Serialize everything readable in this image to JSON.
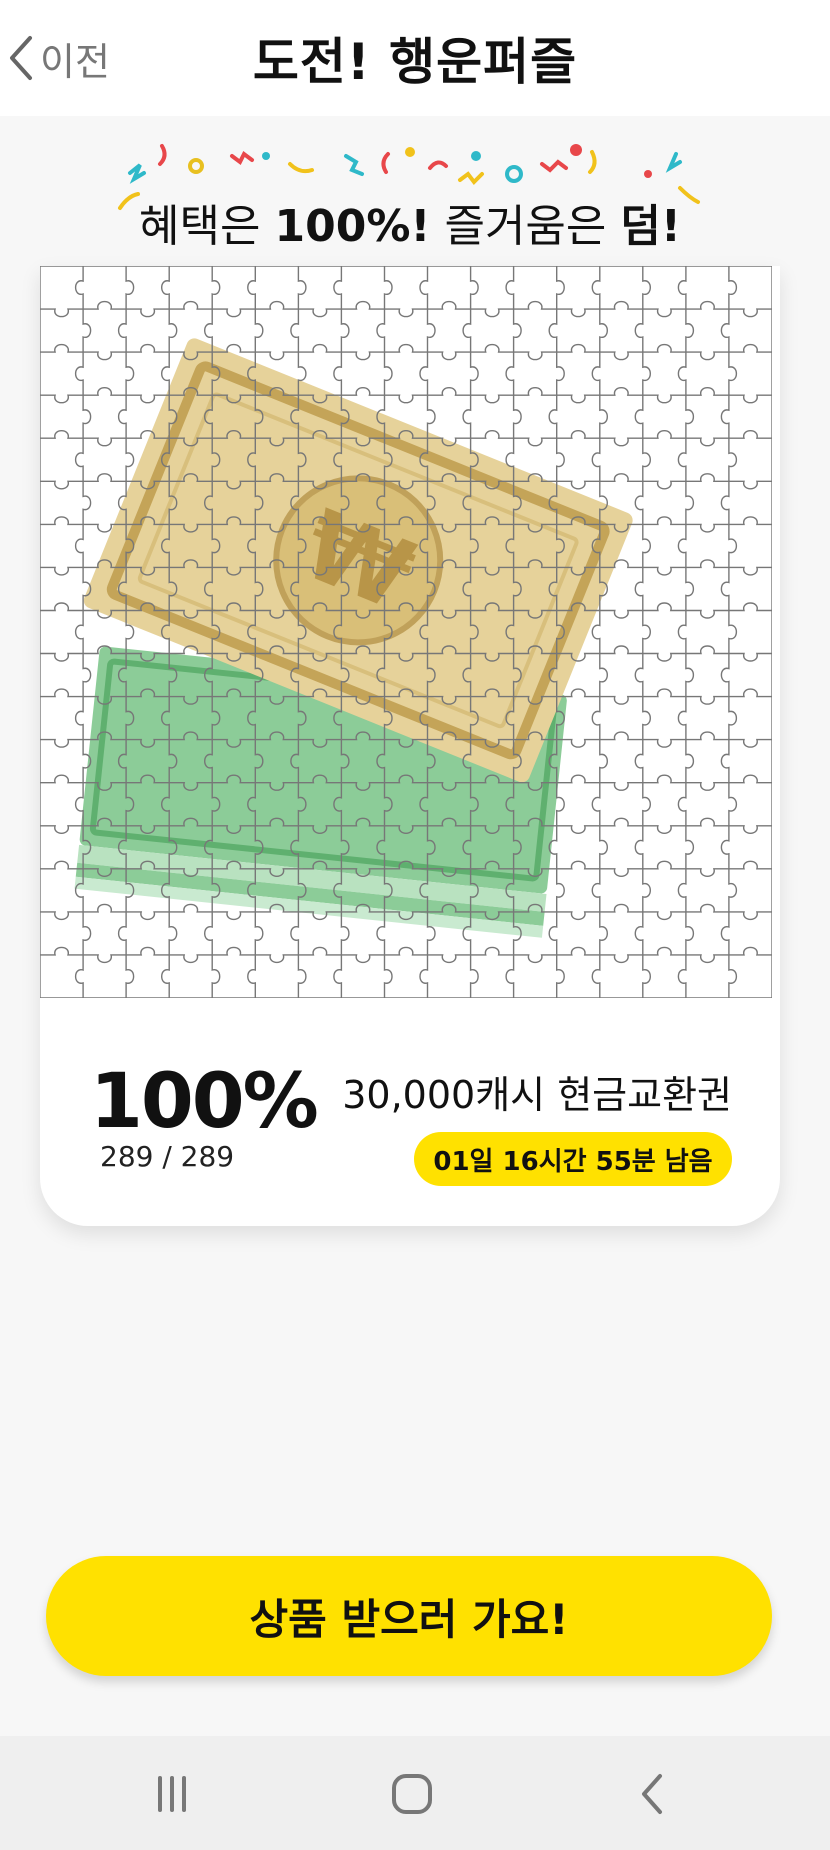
{
  "header": {
    "back_label": "이전",
    "title": "도전! 행운퍼즐"
  },
  "banner": {
    "part1": "혜택은 ",
    "part2": "100%!",
    "part3": " 즐거움은 ",
    "part4": "덤!"
  },
  "puzzle": {
    "image_subject": "cash-banknotes-icon",
    "grid_rows": 17,
    "grid_cols": 17,
    "colors": {
      "gold": "#d9c27a",
      "green": "#9bd3a4"
    }
  },
  "progress": {
    "percent": "100%",
    "count": "289 / 289"
  },
  "prize": {
    "title": "30,000캐시 현금교환권",
    "remaining": "01일 16시간 55분 남음"
  },
  "cta": {
    "label": "상품 받으러 가요!"
  },
  "colors": {
    "accent": "#ffe100"
  },
  "navbar": {
    "icons": [
      "recent-apps-icon",
      "home-icon",
      "back-nav-icon"
    ]
  }
}
